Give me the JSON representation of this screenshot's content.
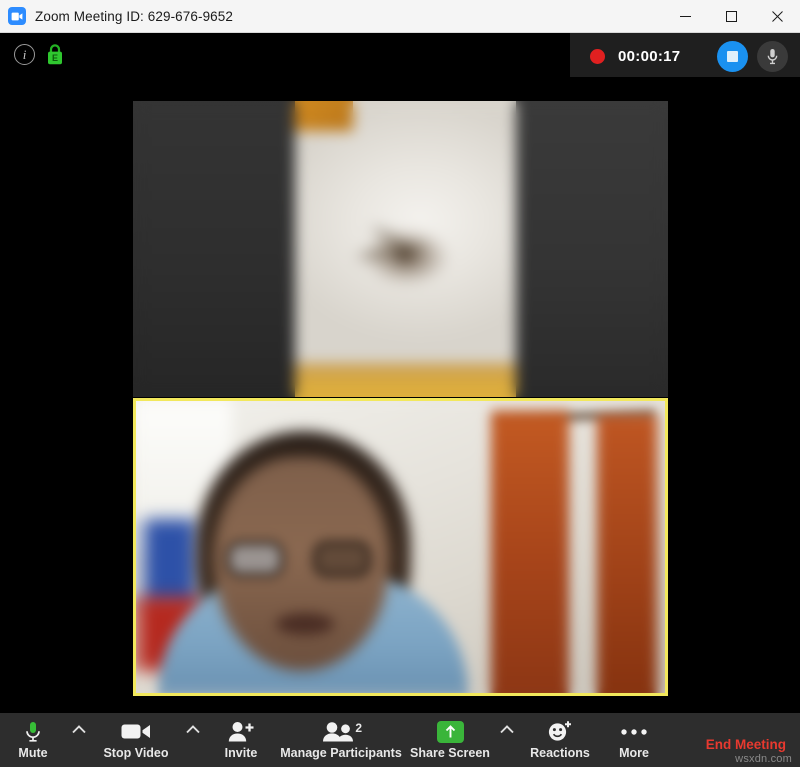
{
  "window": {
    "title": "Zoom Meeting ID: 629-676-9652",
    "logo_icon": "zoom-camera-logo",
    "controls": {
      "minimize_icon": "minimize-icon",
      "maximize_icon": "maximize-icon",
      "close_icon": "close-icon"
    }
  },
  "info_strip": {
    "info_icon": "info-icon",
    "info_glyph": "i",
    "encryption_icon": "green-lock-icon",
    "encryption_glyph": "E"
  },
  "recording": {
    "dot_icon": "recording-dot-icon",
    "elapsed": "00:00:17",
    "stop_icon": "stop-recording-icon",
    "mic_icon": "microphone-icon"
  },
  "stage": {
    "tiles": [
      {
        "name": "participant-video-top",
        "label": "",
        "active_speaker": false,
        "border_color": "#000000"
      },
      {
        "name": "participant-video-bottom",
        "label": "",
        "active_speaker": true,
        "border_color": "#f2e85c"
      }
    ]
  },
  "toolbar": {
    "mute": {
      "label": "Mute",
      "icon": "microphone-icon",
      "caret_icon": "chevron-up-icon"
    },
    "video": {
      "label": "Stop Video",
      "icon": "camera-icon",
      "caret_icon": "chevron-up-icon"
    },
    "invite": {
      "label": "Invite",
      "icon": "add-person-icon"
    },
    "participants": {
      "label": "Manage Participants",
      "icon": "people-icon",
      "count": "2"
    },
    "share": {
      "label": "Share Screen",
      "icon": "share-screen-up-arrow-icon",
      "caret_icon": "chevron-up-icon"
    },
    "reactions": {
      "label": "Reactions",
      "icon": "smiley-plus-icon"
    },
    "more": {
      "label": "More",
      "icon": "ellipsis-icon"
    },
    "end": {
      "label": "End Meeting"
    }
  },
  "watermark": {
    "text": "wsxdn.com"
  },
  "colors": {
    "accent_blue": "#2d8cff",
    "record_red": "#e02020",
    "end_red": "#e8392f",
    "mic_green": "#3ab53a",
    "active_border": "#f2e85c",
    "toolbar_bg": "#2d2d2d"
  }
}
